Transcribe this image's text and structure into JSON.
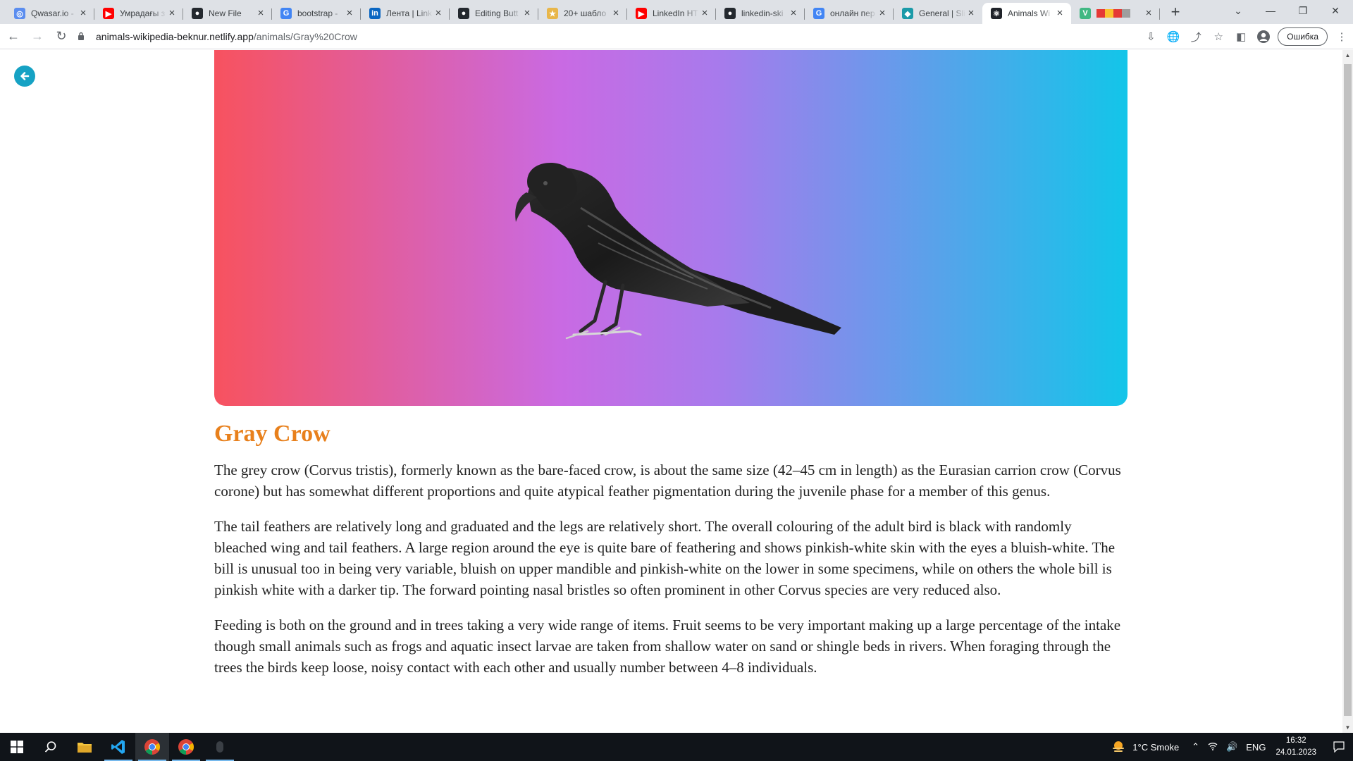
{
  "browser": {
    "tabs": [
      {
        "label": "Qwasar.io -",
        "icon": "qwasar-icon",
        "color": "#5b8def",
        "glyph": "◎"
      },
      {
        "label": "Умрадағы з",
        "icon": "youtube-icon",
        "color": "#ff0000",
        "glyph": "▶"
      },
      {
        "label": "New File",
        "icon": "github-icon",
        "color": "#24292f",
        "glyph": "●"
      },
      {
        "label": "bootstrap -",
        "icon": "google-icon",
        "color": "#4285f4",
        "glyph": "G"
      },
      {
        "label": "Лента | Link",
        "icon": "linkedin-icon",
        "color": "#0a66c2",
        "glyph": "in"
      },
      {
        "label": "Editing Butt",
        "icon": "github-icon",
        "color": "#24292f",
        "glyph": "●"
      },
      {
        "label": "20+ шабло",
        "icon": "codepen-icon",
        "color": "#e8b64a",
        "glyph": "★"
      },
      {
        "label": "LinkedIn HT",
        "icon": "youtube-icon",
        "color": "#ff0000",
        "glyph": "▶"
      },
      {
        "label": "linkedin-ski",
        "icon": "github-icon",
        "color": "#24292f",
        "glyph": "●"
      },
      {
        "label": "онлайн пер",
        "icon": "google-icon",
        "color": "#4285f4",
        "glyph": "G"
      },
      {
        "label": "General | Sli",
        "icon": "slides-icon",
        "color": "#1a9aa8",
        "glyph": "◆"
      },
      {
        "label": "Animals Wi",
        "icon": "react-icon",
        "color": "#20232a",
        "glyph": "⚛",
        "active": true
      },
      {
        "label": "",
        "icon": "vue-icon",
        "color": "#41b883",
        "glyph": "V"
      }
    ],
    "new_tab_label": "+",
    "url_host": "animals-wikipedia-beknur.netlify.app",
    "url_path": "/animals/Gray%20Crow",
    "error_button": "Ошибка"
  },
  "page": {
    "title": "Gray Crow",
    "paragraphs": [
      "The grey crow (Corvus tristis), formerly known as the bare-faced crow, is about the same size (42–45 cm in length) as the Eurasian carrion crow (Corvus corone) but has somewhat different proportions and quite atypical feather pigmentation during the juvenile phase for a member of this genus.",
      "The tail feathers are relatively long and graduated and the legs are relatively short. The overall colouring of the adult bird is black with randomly bleached wing and tail feathers. A large region around the eye is quite bare of feathering and shows pinkish-white skin with the eyes a bluish-white. The bill is unusual too in being very variable, bluish on upper mandible and pinkish-white on the lower in some specimens, while on others the whole bill is pinkish white with a darker tip. The forward pointing nasal bristles so often prominent in other Corvus species are very reduced also.",
      "Feeding is both on the ground and in trees taking a very wide range of items. Fruit seems to be very important making up a large percentage of the intake though small animals such as frogs and aquatic insect larvae are taken from shallow water on sand or shingle beds in rivers. When foraging through the trees the birds keep loose, noisy contact with each other and usually number between 4–8 individuals."
    ],
    "title_color": "#e8801c",
    "accent_color": "#16a2c4"
  },
  "taskbar": {
    "weather": "1°C  Smoke",
    "language": "ENG",
    "time": "16:32",
    "date": "24.01.2023"
  }
}
